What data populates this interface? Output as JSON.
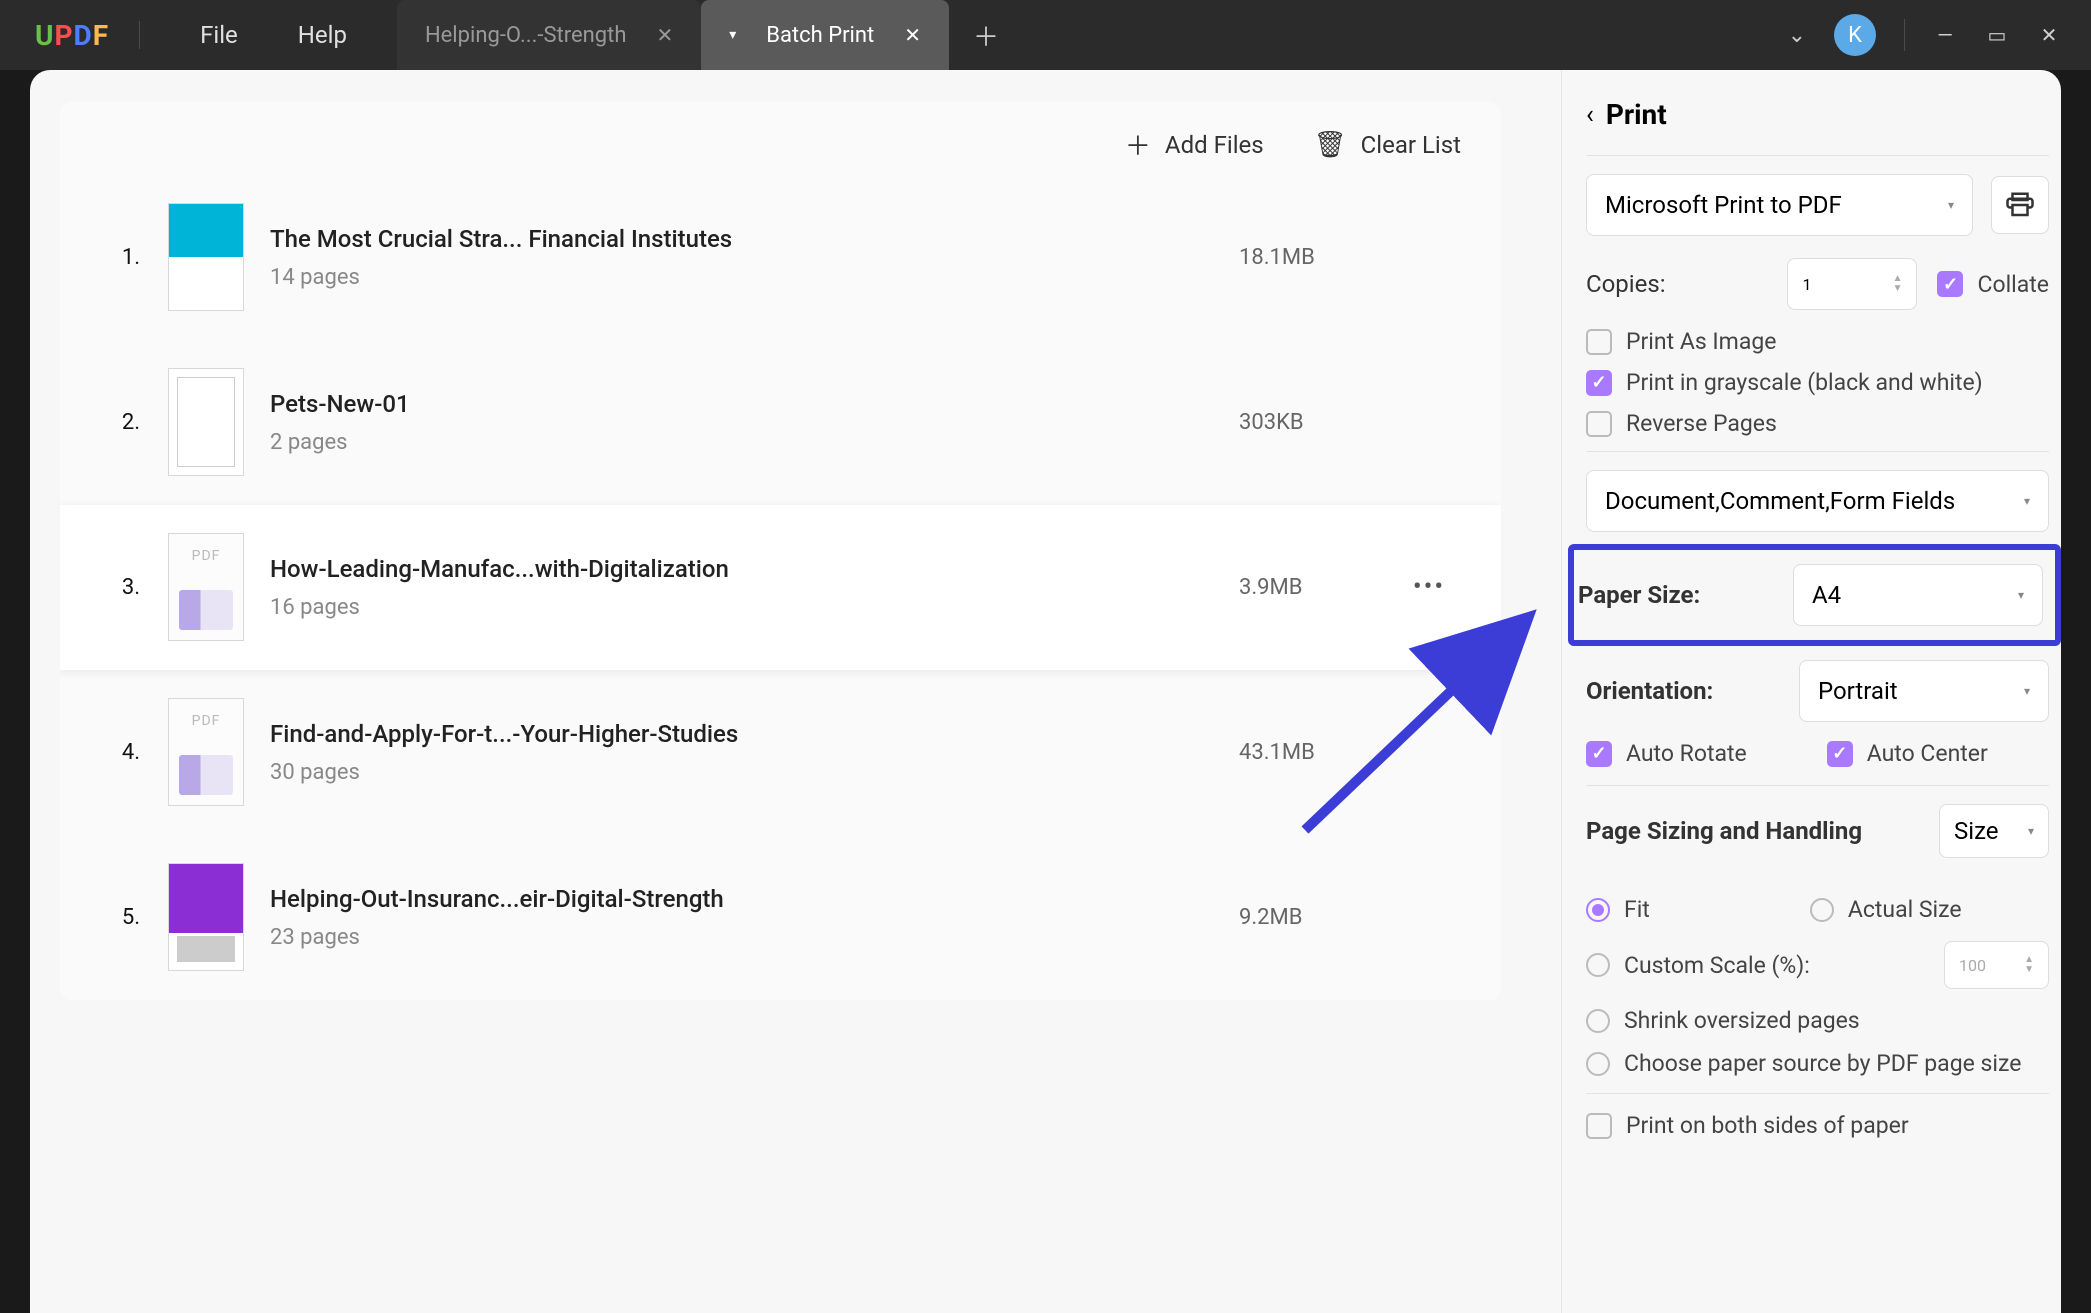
{
  "titlebar": {
    "menu": {
      "file": "File",
      "help": "Help"
    },
    "tab_inactive": "Helping-O...-Strength",
    "tab_active": "Batch Print",
    "avatar": "K"
  },
  "toolbar": {
    "add_files": "Add Files",
    "clear_list": "Clear List"
  },
  "files": [
    {
      "num": "1.",
      "title": "The Most Crucial Stra... Financial Institutes",
      "pages": "14 pages",
      "size": "18.1MB"
    },
    {
      "num": "2.",
      "title": "Pets-New-01",
      "pages": "2 pages",
      "size": "303KB"
    },
    {
      "num": "3.",
      "title": "How-Leading-Manufac...with-Digitalization",
      "pages": "16 pages",
      "size": "3.9MB"
    },
    {
      "num": "4.",
      "title": "Find-and-Apply-For-t...-Your-Higher-Studies",
      "pages": "30 pages",
      "size": "43.1MB"
    },
    {
      "num": "5.",
      "title": "Helping-Out-Insuranc...eir-Digital-Strength",
      "pages": "23 pages",
      "size": "9.2MB"
    }
  ],
  "panel": {
    "title": "Print",
    "printer": "Microsoft Print to PDF",
    "copies_label": "Copies:",
    "copies": "1",
    "collate": "Collate",
    "opt_image": "Print As Image",
    "opt_gray": "Print in grayscale (black and white)",
    "opt_reverse": "Reverse Pages",
    "content_type": "Document,Comment,Form Fields",
    "paper_size_label": "Paper Size:",
    "paper_size": "A4",
    "orientation_label": "Orientation:",
    "orientation": "Portrait",
    "auto_rotate": "Auto Rotate",
    "auto_center": "Auto Center",
    "sizing_label": "Page Sizing and Handling",
    "sizing_mode": "Size",
    "r_fit": "Fit",
    "r_actual": "Actual Size",
    "r_custom": "Custom Scale (%):",
    "custom_val": "100",
    "r_shrink": "Shrink oversized pages",
    "r_source": "Choose paper source by PDF page size",
    "both_sides": "Print on both sides of paper"
  }
}
